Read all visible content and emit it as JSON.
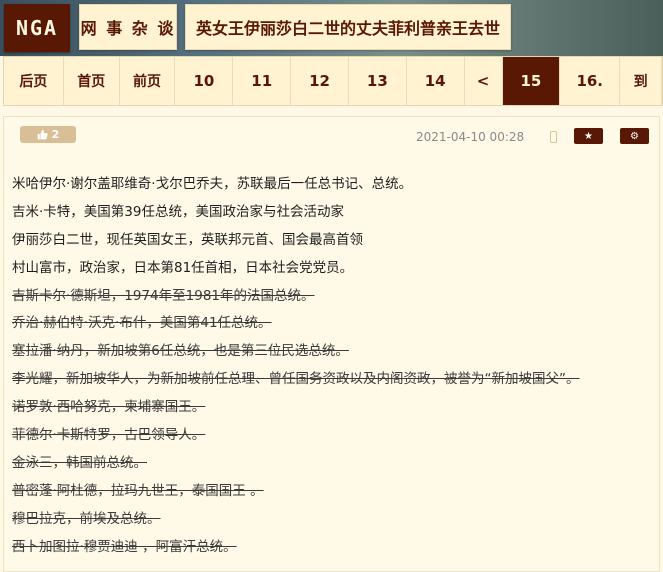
{
  "header": {
    "logo": "NGA",
    "section": "网 事 杂 谈",
    "thread_title": "英女王伊丽莎白二世的丈夫菲利普亲王去世"
  },
  "pagination": {
    "items": [
      {
        "label": "后页",
        "type": "text",
        "active": false
      },
      {
        "label": "首页",
        "type": "text",
        "active": false
      },
      {
        "label": "前页",
        "type": "text",
        "active": false
      },
      {
        "label": "10",
        "type": "num",
        "active": false
      },
      {
        "label": "11",
        "type": "num",
        "active": false
      },
      {
        "label": "12",
        "type": "num",
        "active": false
      },
      {
        "label": "13",
        "type": "num",
        "active": false
      },
      {
        "label": "14",
        "type": "num",
        "active": false
      },
      {
        "label": "<",
        "type": "num",
        "active": false
      },
      {
        "label": "15",
        "type": "num",
        "active": true
      },
      {
        "label": "16.",
        "type": "num",
        "active": false
      },
      {
        "label": "到",
        "type": "text",
        "active": false
      }
    ]
  },
  "post": {
    "vote_count": "2",
    "timestamp": "2021-04-10 00:28",
    "lines": [
      {
        "text": "米哈伊尔·谢尔盖耶维奇·戈尔巴乔夫，苏联最后一任总书记、总统。",
        "struck": false
      },
      {
        "text": "吉米·卡特，美国第39任总统，美国政治家与社会活动家",
        "struck": false
      },
      {
        "text": "伊丽莎白二世，现任英国女王，英联邦元首、国会最高首领",
        "struck": false
      },
      {
        "text": "村山富市，政治家，日本第81任首相，日本社会党党员。",
        "struck": false
      },
      {
        "text": "吉斯卡尔·德斯坦，1974年至1981年的法国总统。",
        "struck": true
      },
      {
        "text": "乔治·赫伯特·沃克·布什，美国第41任总统。",
        "struck": true
      },
      {
        "text": "塞拉潘·纳丹，新加坡第6任总统，也是第三位民选总统。",
        "struck": true
      },
      {
        "text": "李光耀，新加坡华人，为新加坡前任总理、曾任国务资政以及内阁资政，被誉为“新加坡国父”。",
        "struck": true
      },
      {
        "text": "诺罗敦·西哈努克，柬埔寨国王。",
        "struck": true
      },
      {
        "text": "菲德尔·卡斯特罗，古巴领导人。",
        "struck": true
      },
      {
        "text": "金泳三，韩国前总统。",
        "struck": true
      },
      {
        "text": "普密蓬·阿杜德，拉玛九世王，泰国国王 。",
        "struck": true
      },
      {
        "text": "穆巴拉克，前埃及总统。",
        "struck": true
      },
      {
        "text": "西卜加图拉·穆贾迪迪 ，阿富汗总统。",
        "struck": true
      }
    ]
  },
  "colors": {
    "brand": "#591804",
    "panel": "#fff3d2",
    "page_bg": "#fff8e7",
    "vote_bg": "#d9bf98"
  },
  "icons": {
    "vote": "thumbs-up-icon",
    "mobile": "phone-icon",
    "favorite": "star-icon",
    "settings": "gear-icon"
  }
}
